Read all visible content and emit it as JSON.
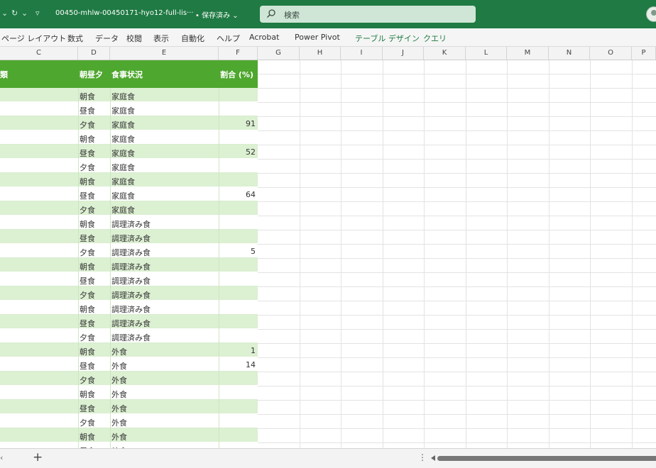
{
  "titlebar": {
    "quick_access": [
      "⌄",
      "↻",
      "⌄",
      "▿"
    ],
    "filename": "00450-mhlw-00450171-hyo12-full-lis···",
    "save_status": "• 保存済み ⌄",
    "search_placeholder": "検索"
  },
  "ribbon": {
    "tabs": [
      "ページ レイアウト",
      "数式",
      "データ",
      "校閲",
      "表示",
      "自動化",
      "ヘルプ",
      "Acrobat",
      "Power Pivot",
      "テーブル デザイン",
      "クエリ"
    ]
  },
  "columns": [
    "C",
    "D",
    "E",
    "F",
    "G",
    "H",
    "I",
    "J",
    "K",
    "L",
    "M",
    "N",
    "O",
    "P"
  ],
  "table": {
    "headers": {
      "c": "類",
      "d": "朝昼夕",
      "e": "食事状況",
      "f": "割合 (%)"
    },
    "rows": [
      {
        "meal": "朝食",
        "status": "家庭食",
        "pct": ""
      },
      {
        "meal": "昼食",
        "status": "家庭食",
        "pct": ""
      },
      {
        "meal": "夕食",
        "status": "家庭食",
        "pct": "91"
      },
      {
        "meal": "朝食",
        "status": "家庭食",
        "pct": ""
      },
      {
        "meal": "昼食",
        "status": "家庭食",
        "pct": "52"
      },
      {
        "meal": "夕食",
        "status": "家庭食",
        "pct": ""
      },
      {
        "meal": "朝食",
        "status": "家庭食",
        "pct": ""
      },
      {
        "meal": "昼食",
        "status": "家庭食",
        "pct": "64"
      },
      {
        "meal": "夕食",
        "status": "家庭食",
        "pct": ""
      },
      {
        "meal": "朝食",
        "status": "調理済み食",
        "pct": ""
      },
      {
        "meal": "昼食",
        "status": "調理済み食",
        "pct": ""
      },
      {
        "meal": "夕食",
        "status": "調理済み食",
        "pct": "5"
      },
      {
        "meal": "朝食",
        "status": "調理済み食",
        "pct": ""
      },
      {
        "meal": "昼食",
        "status": "調理済み食",
        "pct": ""
      },
      {
        "meal": "夕食",
        "status": "調理済み食",
        "pct": ""
      },
      {
        "meal": "朝食",
        "status": "調理済み食",
        "pct": ""
      },
      {
        "meal": "昼食",
        "status": "調理済み食",
        "pct": ""
      },
      {
        "meal": "夕食",
        "status": "調理済み食",
        "pct": ""
      },
      {
        "meal": "朝食",
        "status": "外食",
        "pct": "1"
      },
      {
        "meal": "昼食",
        "status": "外食",
        "pct": "14"
      },
      {
        "meal": "夕食",
        "status": "外食",
        "pct": ""
      },
      {
        "meal": "朝食",
        "status": "外食",
        "pct": ""
      },
      {
        "meal": "昼食",
        "status": "外食",
        "pct": ""
      },
      {
        "meal": "夕食",
        "status": "外食",
        "pct": ""
      },
      {
        "meal": "朝食",
        "status": "外食",
        "pct": ""
      },
      {
        "meal": "昼食",
        "status": "外食",
        "pct": ""
      }
    ]
  },
  "bottombar": {
    "prev_label": "‹",
    "add_sheet_label": "+",
    "more_label": "⋮"
  },
  "colors": {
    "title_bg": "#1f7a43",
    "table_header": "#4ea72e",
    "band": "#dcf0d2",
    "context_tab": "#1f7a43"
  }
}
